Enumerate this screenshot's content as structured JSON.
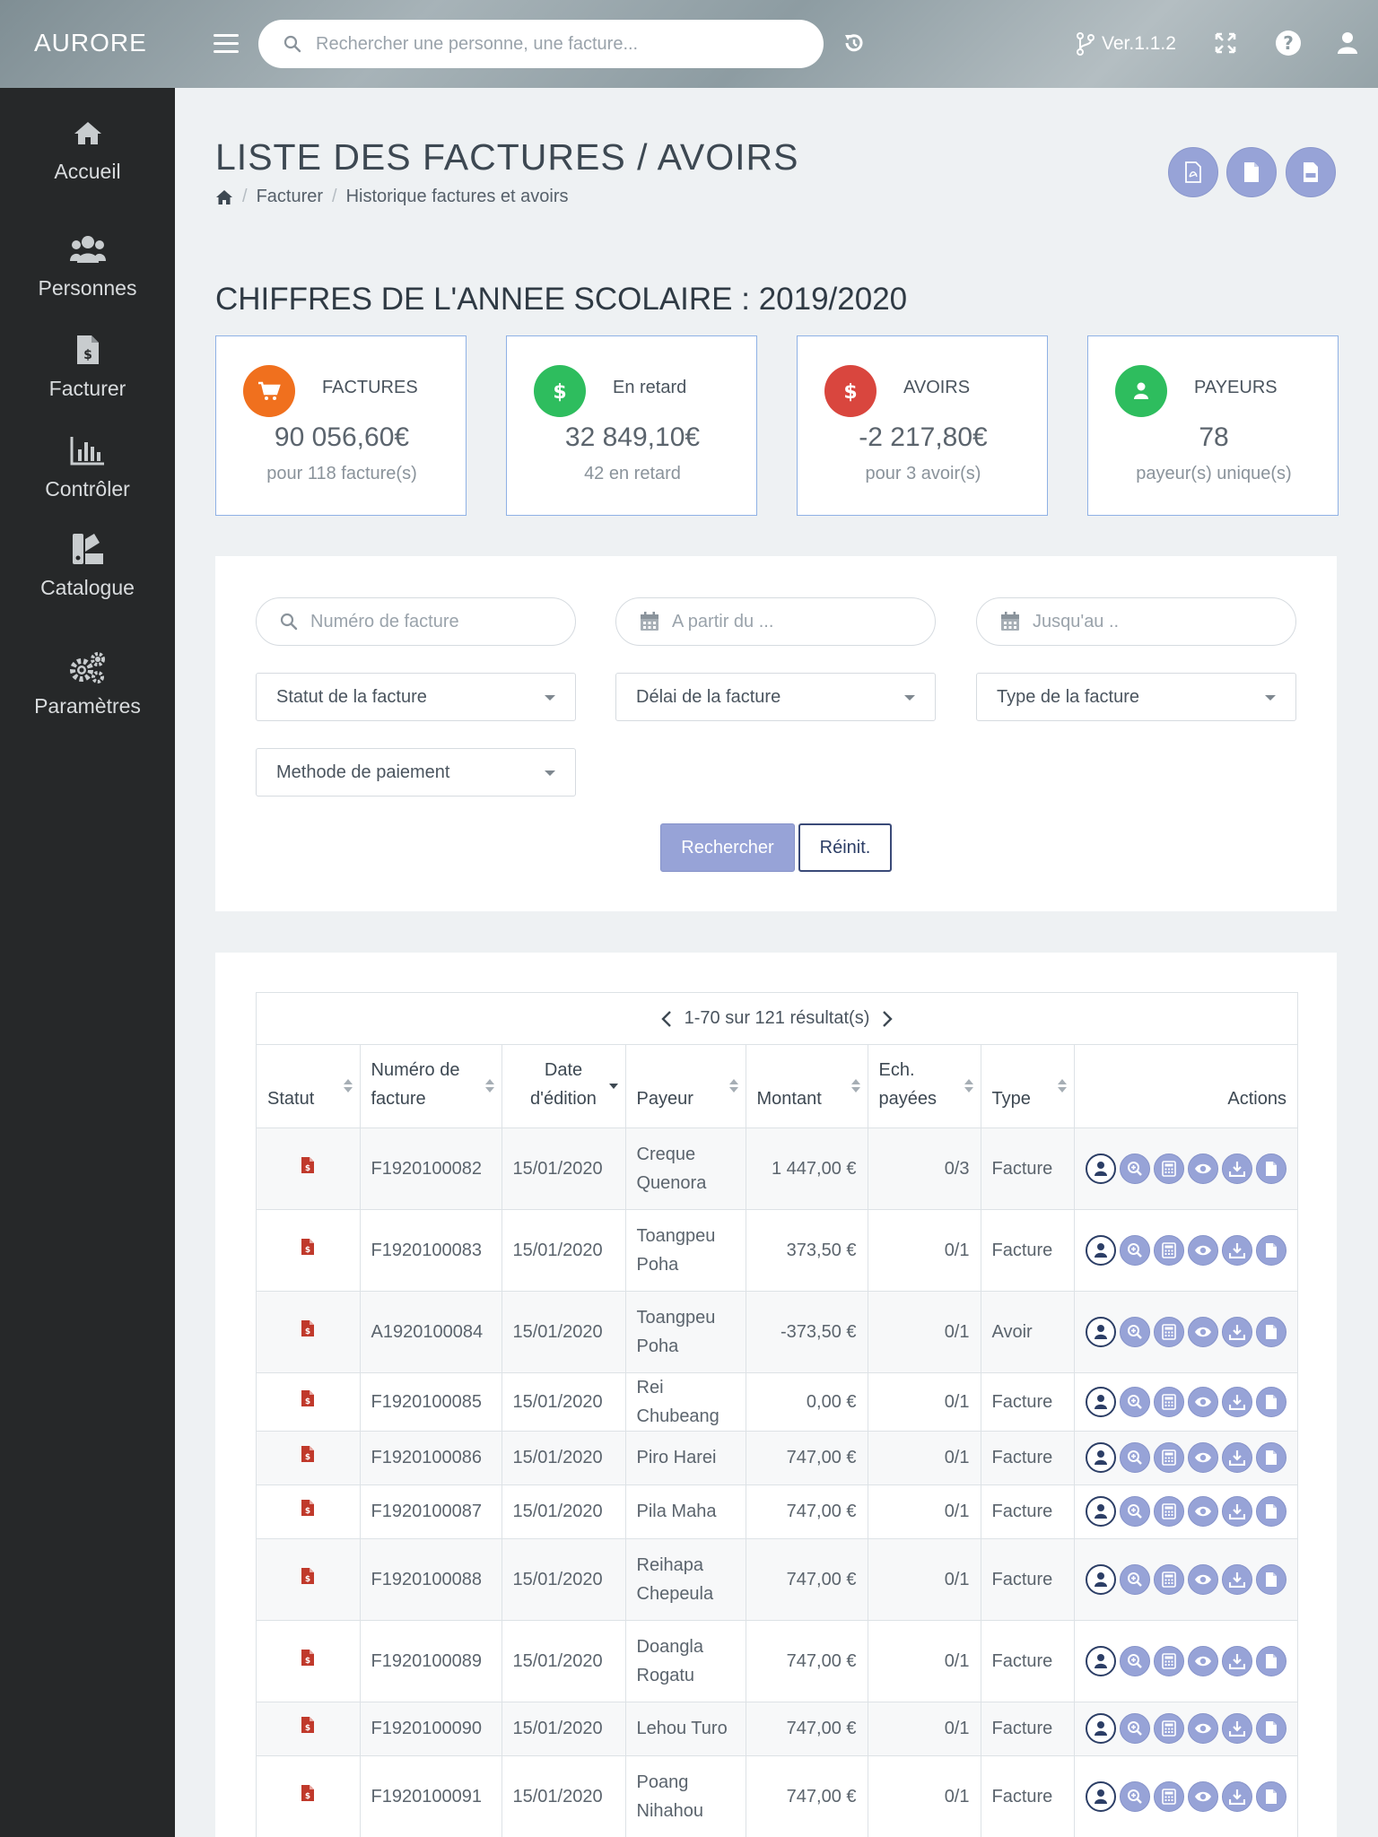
{
  "header": {
    "brand": "AURORE",
    "search_placeholder": "Rechercher une personne, une facture...",
    "version": "Ver.1.1.2"
  },
  "sidebar": {
    "items": [
      {
        "label": "Accueil",
        "icon": "home-icon"
      },
      {
        "label": "Personnes",
        "icon": "users-icon"
      },
      {
        "label": "Facturer",
        "icon": "invoice-icon"
      },
      {
        "label": "Contrôler",
        "icon": "chart-icon"
      },
      {
        "label": "Catalogue",
        "icon": "catalog-icon"
      },
      {
        "label": "Paramètres",
        "icon": "gears-icon"
      }
    ]
  },
  "page": {
    "title": "LISTE DES FACTURES / AVOIRS",
    "breadcrumb": [
      "Facturer",
      "Historique factures et avoirs"
    ],
    "section_title": "CHIFFRES DE L'ANNEE SCOLAIRE : 2019/2020"
  },
  "stats": [
    {
      "title": "FACTURES",
      "value": "90 056,60€",
      "sub": "pour 118 facture(s)",
      "color": "#f0701e",
      "icon": "cart-icon"
    },
    {
      "title": "En retard",
      "value": "32 849,10€",
      "sub": "42 en retard",
      "color": "#2ebd5e",
      "icon": "dollar-icon"
    },
    {
      "title": "AVOIRS",
      "value": "-2 217,80€",
      "sub": "pour 3 avoir(s)",
      "color": "#d9463e",
      "icon": "dollar-icon"
    },
    {
      "title": "PAYEURS",
      "value": "78",
      "sub": "payeur(s) unique(s)",
      "color": "#2ebd5e",
      "icon": "user-icon"
    }
  ],
  "filters": {
    "invoice_number_placeholder": "Numéro de facture",
    "from_placeholder": "A partir du ...",
    "to_placeholder": "Jusqu'au ..",
    "status_select": "Statut de la facture",
    "delay_select": "Délai de la facture",
    "type_select": "Type de la facture",
    "payment_select": "Methode de paiement",
    "search_button": "Rechercher",
    "reset_button": "Réinit."
  },
  "table": {
    "pager_text": "1-70 sur 121 résultat(s)",
    "columns": [
      "Statut",
      "Numéro de facture",
      "Date d'édition",
      "Payeur",
      "Montant",
      "Ech. payées",
      "Type",
      "Actions"
    ],
    "rows": [
      {
        "number": "F1920100082",
        "date": "15/01/2020",
        "payer": "Creque Quenora",
        "amount": "1 447,00 €",
        "ech": "0/3",
        "type": "Facture"
      },
      {
        "number": "F1920100083",
        "date": "15/01/2020",
        "payer": "Toangpeu Poha",
        "amount": "373,50 €",
        "ech": "0/1",
        "type": "Facture"
      },
      {
        "number": "A1920100084",
        "date": "15/01/2020",
        "payer": "Toangpeu Poha",
        "amount": "-373,50 €",
        "ech": "0/1",
        "type": "Avoir"
      },
      {
        "number": "F1920100085",
        "date": "15/01/2020",
        "payer": "Rei Chubeang",
        "amount": "0,00 €",
        "ech": "0/1",
        "type": "Facture"
      },
      {
        "number": "F1920100086",
        "date": "15/01/2020",
        "payer": "Piro Harei",
        "amount": "747,00 €",
        "ech": "0/1",
        "type": "Facture"
      },
      {
        "number": "F1920100087",
        "date": "15/01/2020",
        "payer": "Pila Maha",
        "amount": "747,00 €",
        "ech": "0/1",
        "type": "Facture"
      },
      {
        "number": "F1920100088",
        "date": "15/01/2020",
        "payer": "Reihapa Chepeula",
        "amount": "747,00 €",
        "ech": "0/1",
        "type": "Facture"
      },
      {
        "number": "F1920100089",
        "date": "15/01/2020",
        "payer": "Doangla Rogatu",
        "amount": "747,00 €",
        "ech": "0/1",
        "type": "Facture"
      },
      {
        "number": "F1920100090",
        "date": "15/01/2020",
        "payer": "Lehou Turo",
        "amount": "747,00 €",
        "ech": "0/1",
        "type": "Facture"
      },
      {
        "number": "F1920100091",
        "date": "15/01/2020",
        "payer": "Poang Nihahou",
        "amount": "747,00 €",
        "ech": "0/1",
        "type": "Facture"
      }
    ]
  },
  "colors": {
    "accent": "#97a3d7",
    "sidebar": "#262829",
    "status_icon": "#c0392b"
  }
}
